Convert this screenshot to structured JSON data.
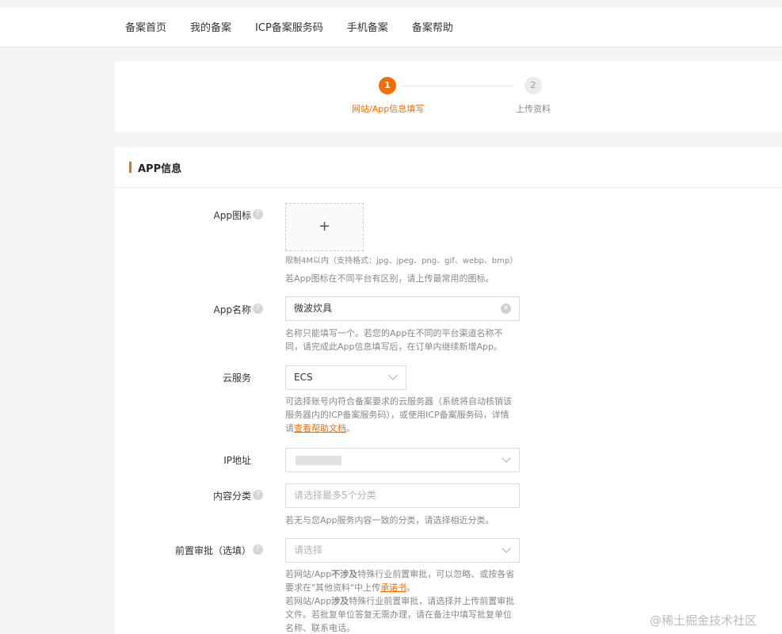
{
  "nav": {
    "items": [
      "备案首页",
      "我的备案",
      "ICP备案服务码",
      "手机备案",
      "备案帮助"
    ]
  },
  "steps": {
    "step1": {
      "num": "1",
      "label": "网站/App信息填写"
    },
    "step2": {
      "num": "2",
      "label": "上传资料"
    }
  },
  "section": {
    "title": "APP信息"
  },
  "form": {
    "icon": {
      "label": "App图标",
      "upload_symbol": "+",
      "size_note": "限制4M以内（支持格式：jpg、jpeg、png、gif、webp、bmp）",
      "desc": "若App图标在不同平台有区别，请上传最常用的图标。"
    },
    "name": {
      "label": "App名称",
      "value": "微波炊具",
      "desc": "名称只能填写一个。若您的App在不同的平台渠道名称不同，请完成此App信息填写后，在订单内继续新增App。"
    },
    "cloud": {
      "label": "云服务",
      "value": "ECS",
      "desc_pre": "可选择账号内符合备案要求的云服务器（系统将自动核销该服务器内的ICP备案服务码），或使用ICP备案服务码，详情请",
      "desc_link": "查看帮助文档",
      "desc_post": "。"
    },
    "ip": {
      "label": "IP地址"
    },
    "category": {
      "label": "内容分类",
      "placeholder": "请选择最多5个分类",
      "desc": "若无与您App服务内容一致的分类，请选择相近分类。"
    },
    "preapproval": {
      "label": "前置审批（选填）",
      "placeholder": "请选择",
      "desc1_pre": "若网站/App",
      "desc1_bold": "不涉及",
      "desc1_post": "特殊行业前置审批，可以忽略、或按各省要求在\"其他资料\"中上传",
      "desc1_link": "承诺书",
      "desc1_end": "。",
      "desc2_pre": "若网站/App",
      "desc2_bold": "涉及",
      "desc2_post": "特殊行业前置审批，请选择并上传前置审批文件。若批复单位答复无需办理，请在备注中填写批复单位名称、联系电话。"
    }
  },
  "watermark": "@稀土掘金技术社区"
}
